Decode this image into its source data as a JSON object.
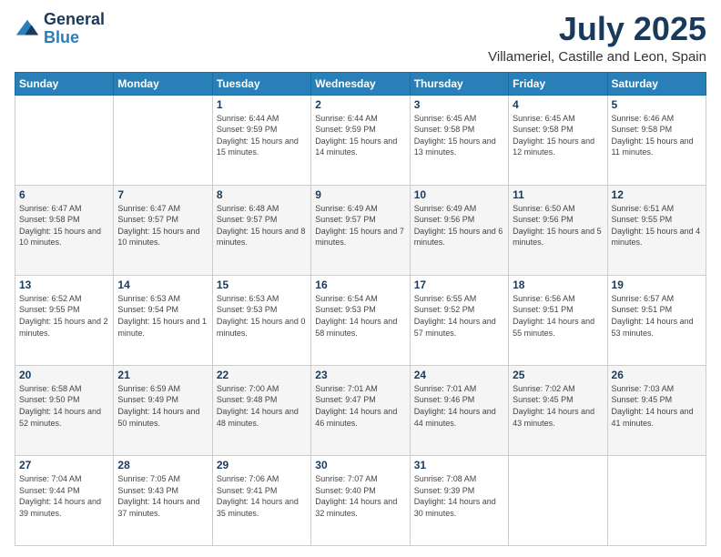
{
  "logo": {
    "line1": "General",
    "line2": "Blue"
  },
  "title": "July 2025",
  "location": "Villameriel, Castille and Leon, Spain",
  "days_header": [
    "Sunday",
    "Monday",
    "Tuesday",
    "Wednesday",
    "Thursday",
    "Friday",
    "Saturday"
  ],
  "weeks": [
    [
      {
        "day": "",
        "sunrise": "",
        "sunset": "",
        "daylight": ""
      },
      {
        "day": "",
        "sunrise": "",
        "sunset": "",
        "daylight": ""
      },
      {
        "day": "1",
        "sunrise": "Sunrise: 6:44 AM",
        "sunset": "Sunset: 9:59 PM",
        "daylight": "Daylight: 15 hours and 15 minutes."
      },
      {
        "day": "2",
        "sunrise": "Sunrise: 6:44 AM",
        "sunset": "Sunset: 9:59 PM",
        "daylight": "Daylight: 15 hours and 14 minutes."
      },
      {
        "day": "3",
        "sunrise": "Sunrise: 6:45 AM",
        "sunset": "Sunset: 9:58 PM",
        "daylight": "Daylight: 15 hours and 13 minutes."
      },
      {
        "day": "4",
        "sunrise": "Sunrise: 6:45 AM",
        "sunset": "Sunset: 9:58 PM",
        "daylight": "Daylight: 15 hours and 12 minutes."
      },
      {
        "day": "5",
        "sunrise": "Sunrise: 6:46 AM",
        "sunset": "Sunset: 9:58 PM",
        "daylight": "Daylight: 15 hours and 11 minutes."
      }
    ],
    [
      {
        "day": "6",
        "sunrise": "Sunrise: 6:47 AM",
        "sunset": "Sunset: 9:58 PM",
        "daylight": "Daylight: 15 hours and 10 minutes."
      },
      {
        "day": "7",
        "sunrise": "Sunrise: 6:47 AM",
        "sunset": "Sunset: 9:57 PM",
        "daylight": "Daylight: 15 hours and 10 minutes."
      },
      {
        "day": "8",
        "sunrise": "Sunrise: 6:48 AM",
        "sunset": "Sunset: 9:57 PM",
        "daylight": "Daylight: 15 hours and 8 minutes."
      },
      {
        "day": "9",
        "sunrise": "Sunrise: 6:49 AM",
        "sunset": "Sunset: 9:57 PM",
        "daylight": "Daylight: 15 hours and 7 minutes."
      },
      {
        "day": "10",
        "sunrise": "Sunrise: 6:49 AM",
        "sunset": "Sunset: 9:56 PM",
        "daylight": "Daylight: 15 hours and 6 minutes."
      },
      {
        "day": "11",
        "sunrise": "Sunrise: 6:50 AM",
        "sunset": "Sunset: 9:56 PM",
        "daylight": "Daylight: 15 hours and 5 minutes."
      },
      {
        "day": "12",
        "sunrise": "Sunrise: 6:51 AM",
        "sunset": "Sunset: 9:55 PM",
        "daylight": "Daylight: 15 hours and 4 minutes."
      }
    ],
    [
      {
        "day": "13",
        "sunrise": "Sunrise: 6:52 AM",
        "sunset": "Sunset: 9:55 PM",
        "daylight": "Daylight: 15 hours and 2 minutes."
      },
      {
        "day": "14",
        "sunrise": "Sunrise: 6:53 AM",
        "sunset": "Sunset: 9:54 PM",
        "daylight": "Daylight: 15 hours and 1 minute."
      },
      {
        "day": "15",
        "sunrise": "Sunrise: 6:53 AM",
        "sunset": "Sunset: 9:53 PM",
        "daylight": "Daylight: 15 hours and 0 minutes."
      },
      {
        "day": "16",
        "sunrise": "Sunrise: 6:54 AM",
        "sunset": "Sunset: 9:53 PM",
        "daylight": "Daylight: 14 hours and 58 minutes."
      },
      {
        "day": "17",
        "sunrise": "Sunrise: 6:55 AM",
        "sunset": "Sunset: 9:52 PM",
        "daylight": "Daylight: 14 hours and 57 minutes."
      },
      {
        "day": "18",
        "sunrise": "Sunrise: 6:56 AM",
        "sunset": "Sunset: 9:51 PM",
        "daylight": "Daylight: 14 hours and 55 minutes."
      },
      {
        "day": "19",
        "sunrise": "Sunrise: 6:57 AM",
        "sunset": "Sunset: 9:51 PM",
        "daylight": "Daylight: 14 hours and 53 minutes."
      }
    ],
    [
      {
        "day": "20",
        "sunrise": "Sunrise: 6:58 AM",
        "sunset": "Sunset: 9:50 PM",
        "daylight": "Daylight: 14 hours and 52 minutes."
      },
      {
        "day": "21",
        "sunrise": "Sunrise: 6:59 AM",
        "sunset": "Sunset: 9:49 PM",
        "daylight": "Daylight: 14 hours and 50 minutes."
      },
      {
        "day": "22",
        "sunrise": "Sunrise: 7:00 AM",
        "sunset": "Sunset: 9:48 PM",
        "daylight": "Daylight: 14 hours and 48 minutes."
      },
      {
        "day": "23",
        "sunrise": "Sunrise: 7:01 AM",
        "sunset": "Sunset: 9:47 PM",
        "daylight": "Daylight: 14 hours and 46 minutes."
      },
      {
        "day": "24",
        "sunrise": "Sunrise: 7:01 AM",
        "sunset": "Sunset: 9:46 PM",
        "daylight": "Daylight: 14 hours and 44 minutes."
      },
      {
        "day": "25",
        "sunrise": "Sunrise: 7:02 AM",
        "sunset": "Sunset: 9:45 PM",
        "daylight": "Daylight: 14 hours and 43 minutes."
      },
      {
        "day": "26",
        "sunrise": "Sunrise: 7:03 AM",
        "sunset": "Sunset: 9:45 PM",
        "daylight": "Daylight: 14 hours and 41 minutes."
      }
    ],
    [
      {
        "day": "27",
        "sunrise": "Sunrise: 7:04 AM",
        "sunset": "Sunset: 9:44 PM",
        "daylight": "Daylight: 14 hours and 39 minutes."
      },
      {
        "day": "28",
        "sunrise": "Sunrise: 7:05 AM",
        "sunset": "Sunset: 9:43 PM",
        "daylight": "Daylight: 14 hours and 37 minutes."
      },
      {
        "day": "29",
        "sunrise": "Sunrise: 7:06 AM",
        "sunset": "Sunset: 9:41 PM",
        "daylight": "Daylight: 14 hours and 35 minutes."
      },
      {
        "day": "30",
        "sunrise": "Sunrise: 7:07 AM",
        "sunset": "Sunset: 9:40 PM",
        "daylight": "Daylight: 14 hours and 32 minutes."
      },
      {
        "day": "31",
        "sunrise": "Sunrise: 7:08 AM",
        "sunset": "Sunset: 9:39 PM",
        "daylight": "Daylight: 14 hours and 30 minutes."
      },
      {
        "day": "",
        "sunrise": "",
        "sunset": "",
        "daylight": ""
      },
      {
        "day": "",
        "sunrise": "",
        "sunset": "",
        "daylight": ""
      }
    ]
  ]
}
